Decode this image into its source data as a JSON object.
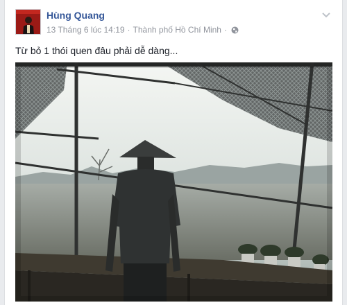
{
  "post": {
    "author": "Hùng Quang",
    "timestamp": "13 Tháng 6 lúc 14:19",
    "separator": "·",
    "location": "Thành phố Hồ Chí Minh",
    "privacy_icon": "globe-icon",
    "menu_icon": "chevron-down-icon",
    "text": "Từ bỏ 1 thói quen đâu phải dễ dàng...",
    "photo_subject": "man-in-conical-hat-in-greenhouse"
  },
  "colors": {
    "author_link": "#365899",
    "meta_text": "#90949c",
    "body_text": "#1d2129",
    "background": "#e9ebee"
  }
}
